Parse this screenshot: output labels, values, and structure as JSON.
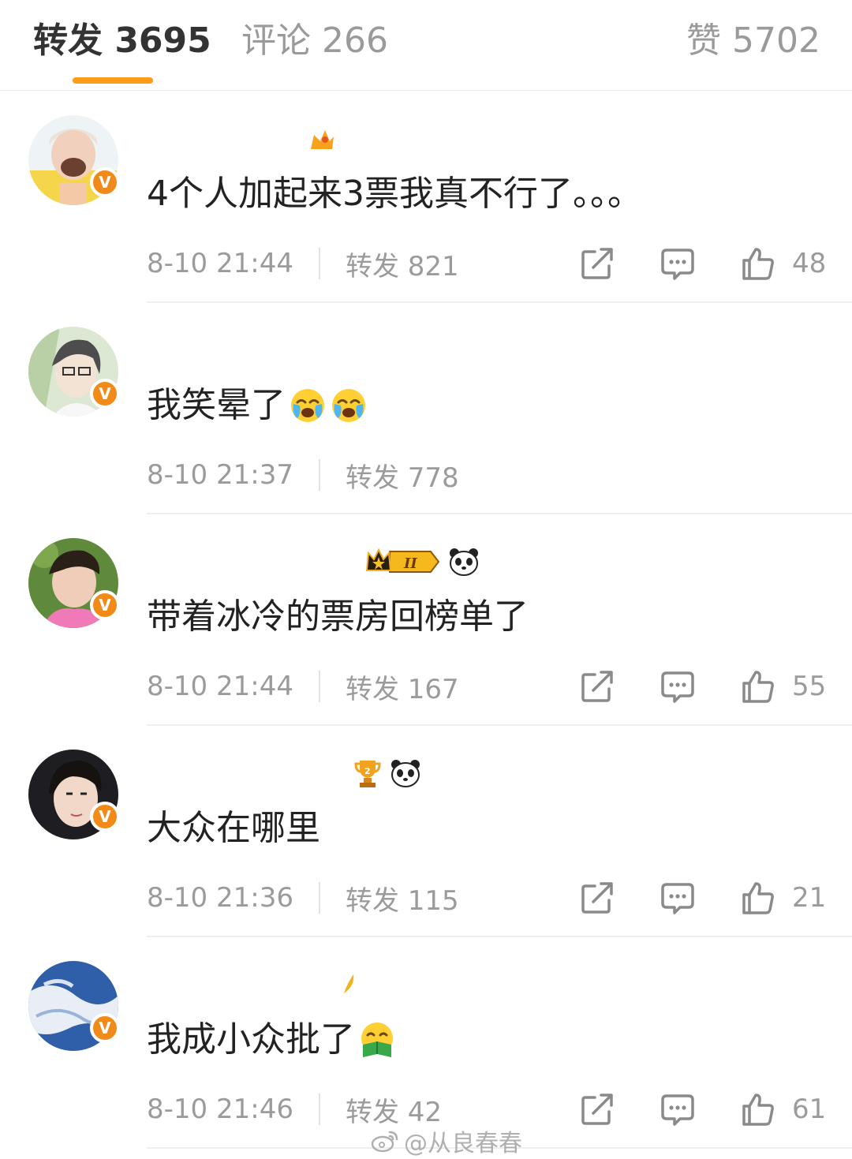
{
  "tabs": {
    "reposts": "转发 3695",
    "comments": "评论 266",
    "likes": "赞 5702"
  },
  "colors": {
    "accent": "#ff9b1a",
    "verified": "#f28a1a"
  },
  "comments": [
    {
      "text": "4个人加起来3票我真不行了。。。",
      "time": "8-10 21:44",
      "reposts": "转发 821",
      "likes": "48"
    },
    {
      "text": "我笑晕了",
      "time": "8-10 21:37",
      "reposts": "转发 778",
      "likes": ""
    },
    {
      "text": "带着冰冷的票房回榜单了",
      "time": "8-10 21:44",
      "reposts": "转发 167",
      "likes": "55"
    },
    {
      "text": "大众在哪里",
      "time": "8-10 21:36",
      "reposts": "转发 115",
      "likes": "21"
    },
    {
      "text": "我成小众批了",
      "time": "8-10 21:46",
      "reposts": "转发 42",
      "likes": "61"
    }
  ],
  "verified_mark": "V",
  "watermark": "@从良春春"
}
